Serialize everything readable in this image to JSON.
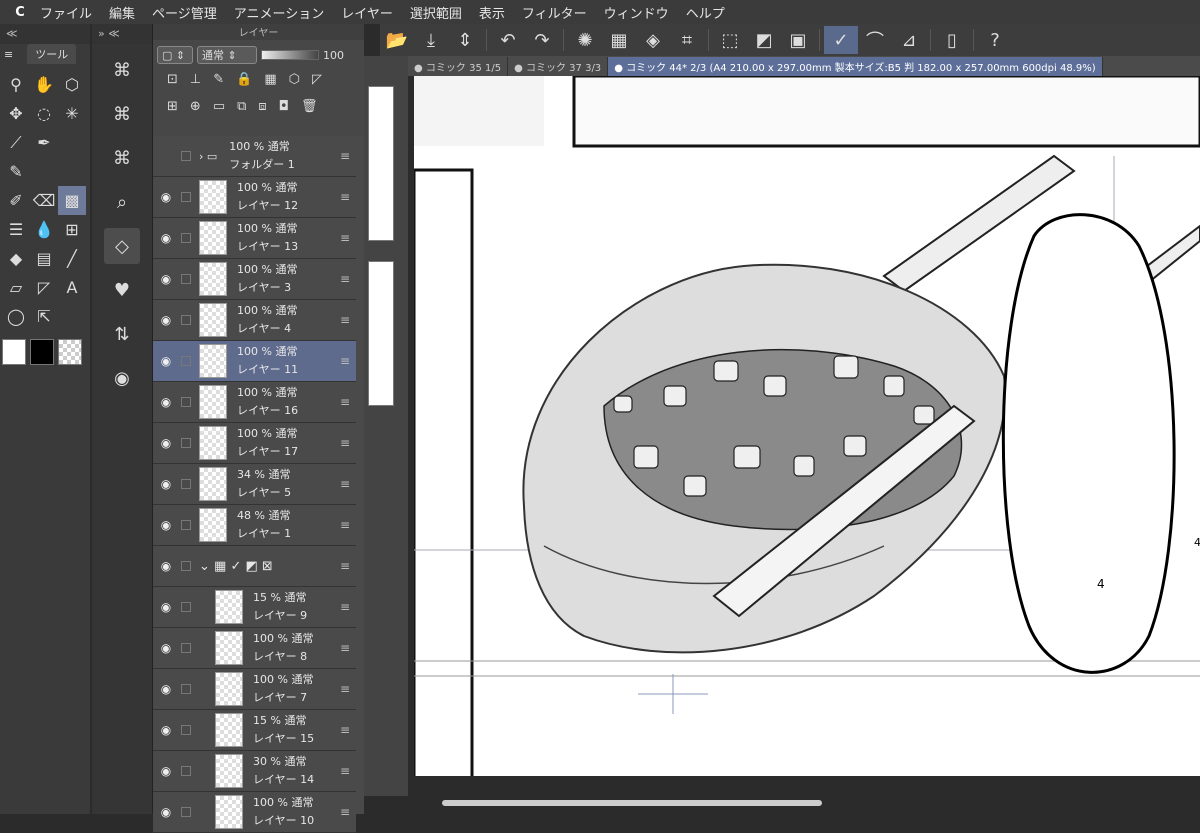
{
  "menu": [
    "ファイル",
    "編集",
    "ページ管理",
    "アニメーション",
    "レイヤー",
    "選択範囲",
    "表示",
    "フィルター",
    "ウィンドウ",
    "ヘルプ"
  ],
  "tool_panel": {
    "header": "≪",
    "tab_label": "ツール"
  },
  "layer_panel": {
    "title": "レイヤー",
    "blend_mode": "通常",
    "opacity_value": "100",
    "layers": [
      {
        "pct": "100 % 通常",
        "name": "フォルダー 1",
        "type": "folder"
      },
      {
        "pct": "100 % 通常",
        "name": "レイヤー 12"
      },
      {
        "pct": "100 % 通常",
        "name": "レイヤー 13"
      },
      {
        "pct": "100 % 通常",
        "name": "レイヤー 3"
      },
      {
        "pct": "100 % 通常",
        "name": "レイヤー 4"
      },
      {
        "pct": "100 % 通常",
        "name": "レイヤー 11",
        "selected": true
      },
      {
        "pct": "100 % 通常",
        "name": "レイヤー 16"
      },
      {
        "pct": "100 % 通常",
        "name": "レイヤー 17"
      },
      {
        "pct": "34 % 通常",
        "name": "レイヤー 5"
      },
      {
        "pct": "48 % 通常",
        "name": "レイヤー 1"
      },
      {
        "pct": "",
        "name": "",
        "type": "group"
      },
      {
        "pct": "15 % 通常",
        "name": "レイヤー 9",
        "indent": true
      },
      {
        "pct": "100 % 通常",
        "name": "レイヤー 8",
        "indent": true
      },
      {
        "pct": "100 % 通常",
        "name": "レイヤー 7",
        "indent": true
      },
      {
        "pct": "15 % 通常",
        "name": "レイヤー 15",
        "indent": true
      },
      {
        "pct": "30 % 通常",
        "name": "レイヤー 14",
        "indent": true
      },
      {
        "pct": "100 % 通常",
        "name": "レイヤー 10",
        "indent": true
      }
    ]
  },
  "canvas_tabs": [
    {
      "label": "● コミック 35 1/5"
    },
    {
      "label": "● コミック 37 3/3"
    },
    {
      "label": "● コミック 44* 2/3 (A4 210.00 x 297.00mm 製本サイズ:B5 判 182.00 x 257.00mm 600dpi 48.9%)",
      "active": true
    }
  ],
  "page_number": "4",
  "side_page_number": "4",
  "colors": {
    "accent": "#5e6b8d",
    "panel": "#4a4a4a"
  }
}
